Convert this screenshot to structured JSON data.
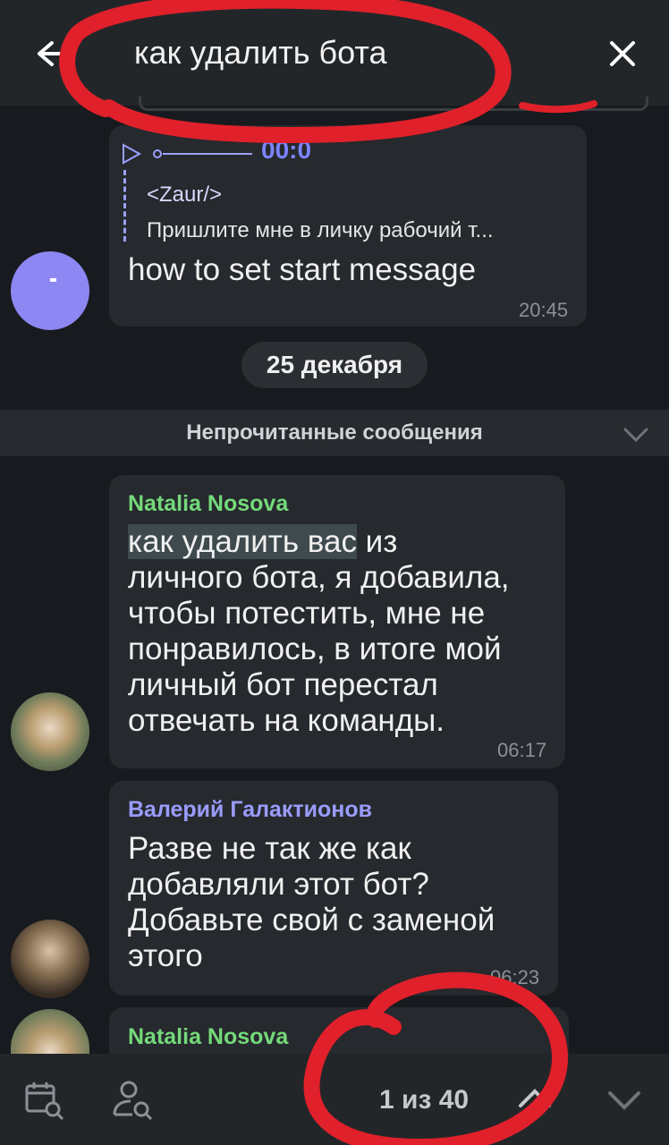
{
  "search": {
    "query": "как удалить бота"
  },
  "messages": [
    {
      "reply": {
        "player_time": "00:0",
        "author": "<Zaur/>",
        "text": "Пришлите мне в личку рабочий т..."
      },
      "text": "how to set start message",
      "time": "20:45"
    },
    {
      "author": "Natalia Nosova",
      "highlight": "как удалить вас",
      "lines": [
        " из",
        "личного бота, я добавила,",
        "чтобы потестить, мне не",
        "понравилось, в итоге мой",
        "личный бот перестал",
        "отвечать на команды."
      ],
      "time": "06:17"
    },
    {
      "author": "Валерий Галактионов",
      "lines": [
        "Разве не так же как",
        "добавляли этот бот?",
        "Добавьте свой с заменой",
        "этого"
      ],
      "time": "06:23"
    },
    {
      "author": "Natalia Nosova"
    }
  ],
  "date_separator": "25 декабря",
  "unread_label": "Непрочитанные сообщения",
  "bottom": {
    "counter": "1 из 40"
  },
  "colors": {
    "background": "#171a1e",
    "bubble": "#26292d",
    "bar": "#232629",
    "author_green": "#74d97a",
    "author_blue": "#9a9cff",
    "annotation_red": "#e0202a"
  },
  "icons": [
    "back-arrow-icon",
    "close-icon",
    "calendar-search-icon",
    "user-search-icon",
    "chevron-up-icon",
    "chevron-down-icon"
  ]
}
